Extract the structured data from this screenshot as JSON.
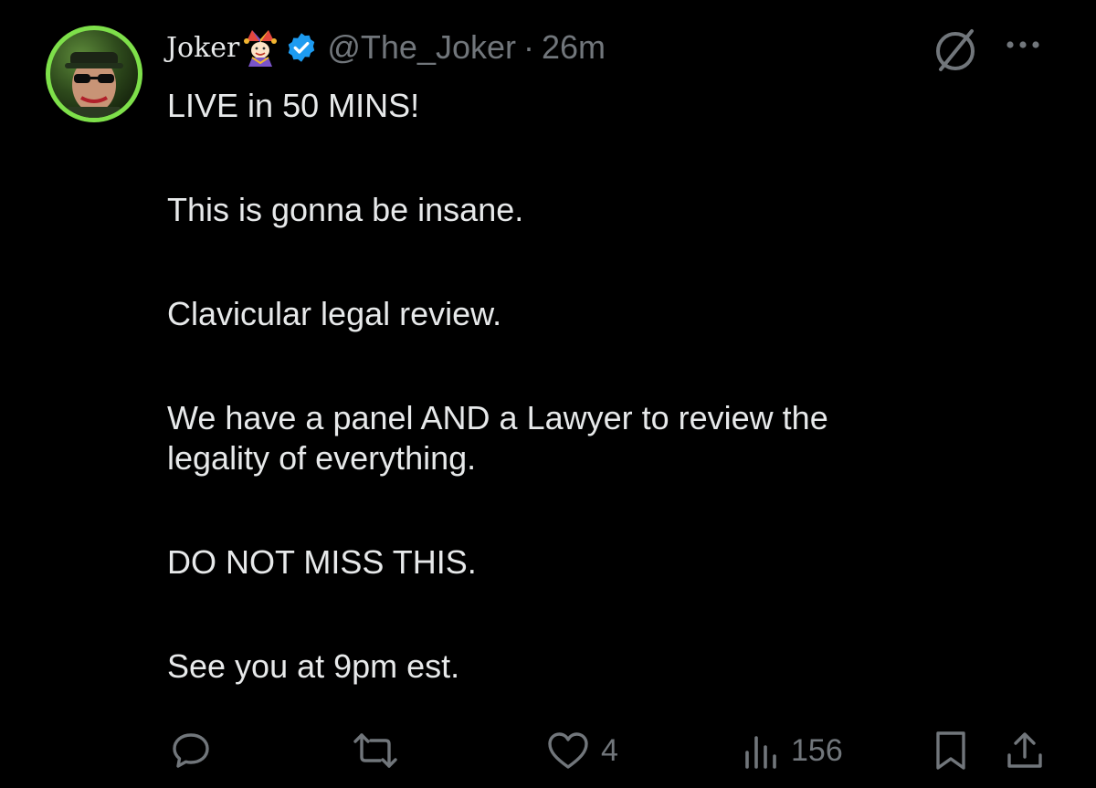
{
  "author": {
    "name": "Joker",
    "handle": "@The_Joker",
    "separator": "·",
    "timestamp": "26m",
    "verified": true,
    "badge_emoji_icon": "jester-emoji-icon",
    "verified_color": "#1d9bf0"
  },
  "tweet": {
    "lines": [
      "LIVE in 50 MINS!",
      "This is gonna be insane.",
      "Clavicular legal review.",
      "We have a panel AND a Lawyer to review the",
      "legality of everything.",
      "DO NOT MISS THIS.",
      "See you at 9pm est."
    ]
  },
  "actions": {
    "reply_count": "",
    "repost_count": "",
    "like_count": "4",
    "views_count": "156"
  },
  "icons": {
    "reply": "reply-icon",
    "repost": "repost-icon",
    "like": "heart-icon",
    "views": "views-bar-chart-icon",
    "bookmark": "bookmark-icon",
    "share": "share-icon",
    "grok": "grok-icon",
    "more": "more-horizontal-icon"
  },
  "colors": {
    "background": "#000000",
    "text": "#e7e9ea",
    "muted": "#71767b",
    "avatar_ring": "#7ee04a"
  }
}
